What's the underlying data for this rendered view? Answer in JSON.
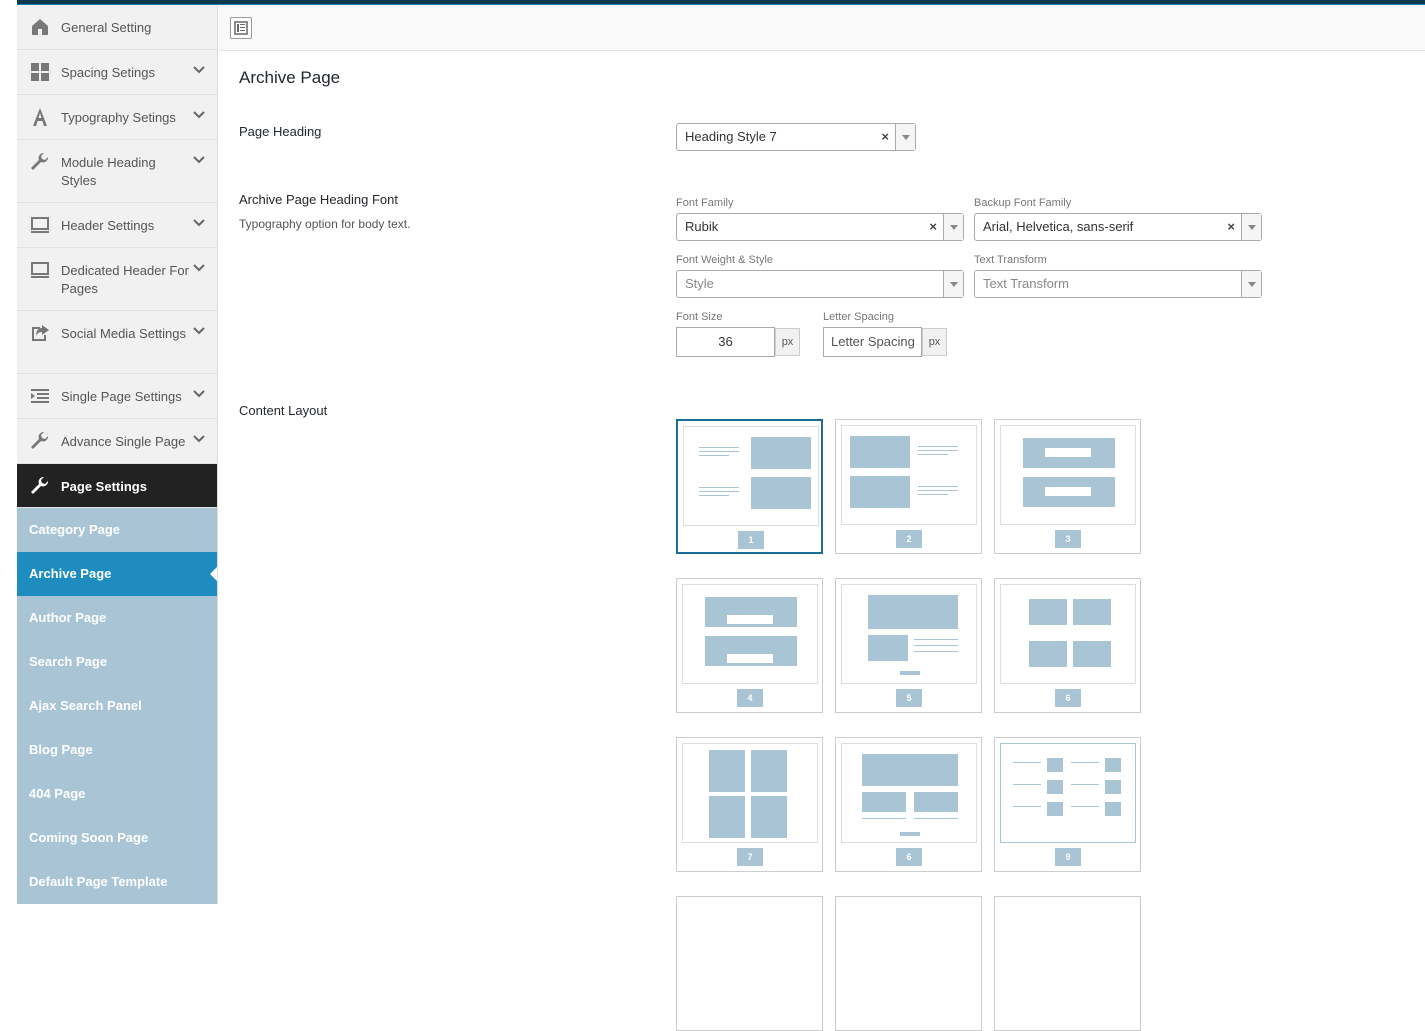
{
  "sidebar": {
    "items": [
      {
        "label": "General Setting",
        "icon": "home-icon",
        "chevron": false
      },
      {
        "label": "Spacing Setings",
        "icon": "grid-icon",
        "chevron": true
      },
      {
        "label": "Typography Setings",
        "icon": "typography-icon",
        "chevron": true
      },
      {
        "label": "Module Heading Styles",
        "icon": "wrench-icon",
        "chevron": true
      },
      {
        "label": "Header Settings",
        "icon": "monitor-icon",
        "chevron": true
      },
      {
        "label": "Dedicated Header For Pages",
        "icon": "monitor-icon",
        "chevron": true
      },
      {
        "label": "Social Media Settings",
        "icon": "share-icon",
        "chevron": true
      },
      {
        "label": "Single Page Settings",
        "icon": "list-icon",
        "chevron": true
      },
      {
        "label": "Advance Single Page",
        "icon": "wrench-icon",
        "chevron": true
      },
      {
        "label": "Page Settings",
        "icon": "wrench-icon",
        "chevron": false
      }
    ],
    "subitems": [
      "Category Page",
      "Archive Page",
      "Author Page",
      "Search Page",
      "Ajax Search Panel",
      "Blog Page",
      "404 Page",
      "Coming Soon Page",
      "Default Page Template"
    ]
  },
  "main": {
    "title": "Archive Page",
    "page_heading": {
      "label": "Page Heading",
      "value": "Heading Style 7"
    },
    "font": {
      "label": "Archive Page Heading Font",
      "desc": "Typography option for body text.",
      "family_label": "Font Family",
      "family_value": "Rubik",
      "backup_label": "Backup Font Family",
      "backup_value": "Arial, Helvetica, sans-serif",
      "weight_label": "Font Weight & Style",
      "weight_placeholder": "Style",
      "transform_label": "Text Transform",
      "transform_placeholder": "Text Transform",
      "size_label": "Font Size",
      "size_value": "36",
      "size_unit": "px",
      "spacing_label": "Letter Spacing",
      "spacing_placeholder": "Letter Spacing",
      "spacing_unit": "px"
    },
    "content_layout": {
      "label": "Content Layout",
      "options": [
        "1",
        "2",
        "3",
        "4",
        "5",
        "6",
        "7",
        "6",
        "9"
      ],
      "selected": "1"
    }
  },
  "colors": {
    "accent": "#1e8cbe",
    "sidebar_sub": "#a9c5d5",
    "active_dark": "#222222"
  }
}
